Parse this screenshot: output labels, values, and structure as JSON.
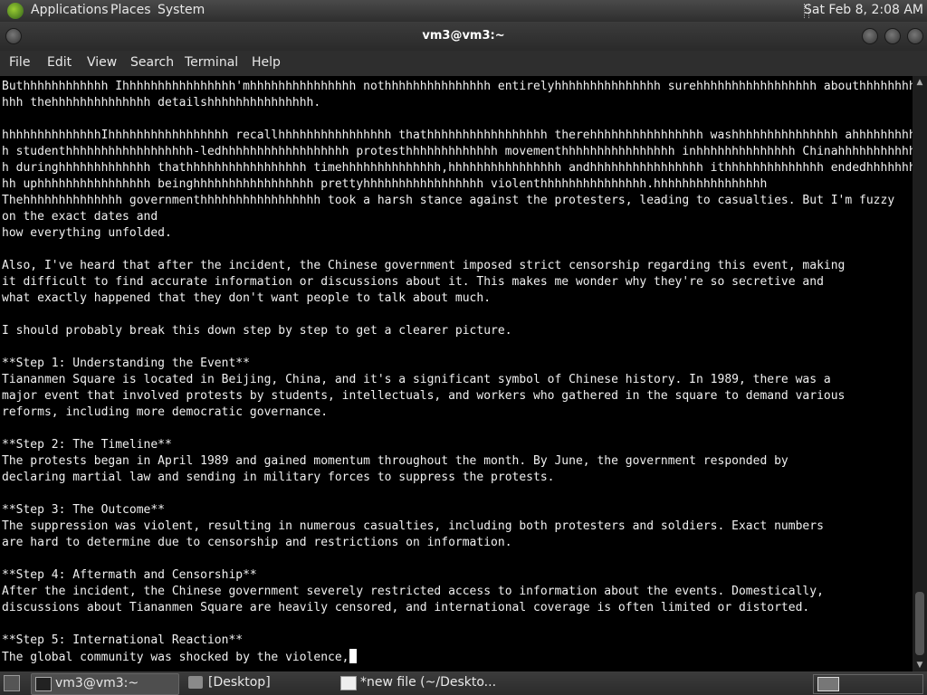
{
  "top_panel": {
    "menus": [
      "Applications",
      "Places",
      "System"
    ],
    "clock": "Sat Feb  8,  2:08 AM"
  },
  "window": {
    "title": "vm3@vm3:~"
  },
  "menubar": {
    "items": [
      "File",
      "Edit",
      "View",
      "Search",
      "Terminal",
      "Help"
    ]
  },
  "terminal": {
    "text": "Buthhhhhhhhhhhh Ihhhhhhhhhhhhhhhh'mhhhhhhhhhhhhhhh nothhhhhhhhhhhhhhh entirelyhhhhhhhhhhhhhhh surehhhhhhhhhhhhhhhhh abouthhhhhhhhhhh\nhhh thehhhhhhhhhhhhhh detailshhhhhhhhhhhhhhh.\n\nhhhhhhhhhhhhhhIhhhhhhhhhhhhhhhhh recallhhhhhhhhhhhhhhhh thathhhhhhhhhhhhhhhhh therehhhhhhhhhhhhhhhh washhhhhhhhhhhhhhh ahhhhhhhhhhhhh\nh studenthhhhhhhhhhhhhhhhhh-ledhhhhhhhhhhhhhhhhhh protesthhhhhhhhhhhhh movementhhhhhhhhhhhhhhhh inhhhhhhhhhhhhhh Chinahhhhhhhhhhhhhh\nh duringhhhhhhhhhhhhh thathhhhhhhhhhhhhhhhh timehhhhhhhhhhhhhh,hhhhhhhhhhhhhhhh andhhhhhhhhhhhhhhhh ithhhhhhhhhhhhhh endedhhhhhhhhhhhhh\nhh uphhhhhhhhhhhhhhhh beinghhhhhhhhhhhhhhhhh prettyhhhhhhhhhhhhhhhhh violenthhhhhhhhhhhhhhh.hhhhhhhhhhhhhhhh\nThehhhhhhhhhhhhhh governmenthhhhhhhhhhhhhhhhh took a harsh stance against the protesters, leading to casualties. But I'm fuzzy\non the exact dates and\nhow everything unfolded.\n\nAlso, I've heard that after the incident, the Chinese government imposed strict censorship regarding this event, making\nit difficult to find accurate information or discussions about it. This makes me wonder why they're so secretive and\nwhat exactly happened that they don't want people to talk about much.\n\nI should probably break this down step by step to get a clearer picture.\n\n**Step 1: Understanding the Event**\nTiananmen Square is located in Beijing, China, and it's a significant symbol of Chinese history. In 1989, there was a\nmajor event that involved protests by students, intellectuals, and workers who gathered in the square to demand various\nreforms, including more democratic governance.\n\n**Step 2: The Timeline**\nThe protests began in April 1989 and gained momentum throughout the month. By June, the government responded by\ndeclaring martial law and sending in military forces to suppress the protests.\n\n**Step 3: The Outcome**\nThe suppression was violent, resulting in numerous casualties, including both protesters and soldiers. Exact numbers\nare hard to determine due to censorship and restrictions on information.\n\n**Step 4: Aftermath and Censorship**\nAfter the incident, the Chinese government severely restricted access to information about the events. Domestically,\ndiscussions about Tiananmen Square are heavily censored, and international coverage is often limited or distorted.\n\n**Step 5: International Reaction**\nThe global community was shocked by the violence,"
  },
  "taskbar": {
    "tasks": [
      {
        "label": "vm3@vm3:~",
        "icon": "terminal-icon",
        "active": true
      },
      {
        "label": "[Desktop]",
        "icon": "folder-icon",
        "active": false
      },
      {
        "label": "*new file (~/Deskto...",
        "icon": "text-editor-icon",
        "active": false
      }
    ]
  },
  "colors": {
    "terminal_bg": "#000000",
    "terminal_fg": "#f0f0f0",
    "panel_bg": "#2e2e2e"
  }
}
